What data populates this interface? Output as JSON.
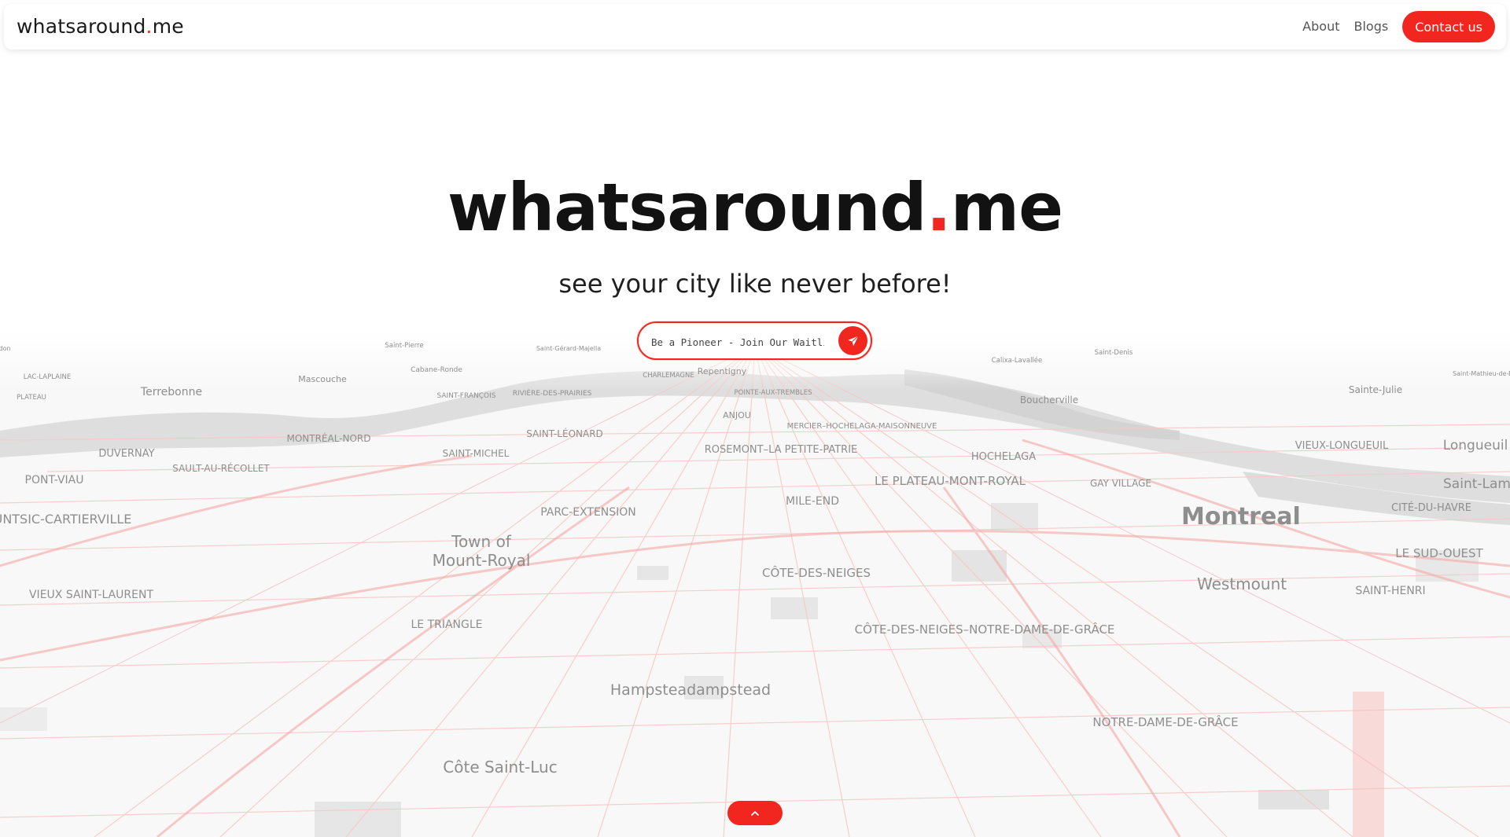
{
  "navbar": {
    "brand": {
      "name": "whatsaround",
      "dot": ".",
      "tld": "me"
    },
    "links": {
      "about": "About",
      "blogs": "Blogs"
    },
    "contact_label": "Contact us"
  },
  "hero": {
    "title": {
      "name": "whatsaround",
      "dot": ".",
      "tld": "me"
    },
    "tagline": "see your city like never before!"
  },
  "waitlist": {
    "placeholder": "Be a Pioneer - Join Our Waitlist",
    "send_icon": "send-icon"
  },
  "scroll_top": {
    "icon": "chevron-up-icon"
  },
  "map": {
    "labels": {
      "l1": "Montreal",
      "l2": "Westmount",
      "l3": "Town of",
      "l4": "Mount-Royal",
      "l5": "Côte Saint-Luc",
      "l6": "Hampsteadampstead",
      "l7": "Terrebonne",
      "l8": "Mascouche",
      "l9": "Boucherville",
      "l10": "Sainte-Julie",
      "l11": "Longueuil",
      "l12": "Saint-Lam",
      "l13": "Repentigny",
      "l14": "Saint-Pierre",
      "l15": "Saint-Gérard-Majella",
      "l16": "Calixa-Lavallée",
      "l17": "Saint-Denis",
      "l18": "Cabane-Ronde",
      "l19": "CHARLEMAGNE",
      "l20": "LAC-LAPLAINE",
      "l21": "PLATEAU",
      "l22": "SAINT-FRANÇOIS",
      "l23": "RIVIÈRE-DES-PRAIRIES",
      "l24": "POINTE-AUX-TREMBLES",
      "l25": "ANJOU",
      "l26": "MERCIER–HOCHELAGA-MAISONNEUVE",
      "l27": "DUVERNAY",
      "l28": "MONTRÉAL-NORD",
      "l29": "SAINT-LÉONARD",
      "l30": "ROSEMONT–LA PETITE-PATRIE",
      "l31": "HOCHELAGA",
      "l32": "VIEUX-LONGUEUIL",
      "l33": "PONT-VIAU",
      "l34": "SAULT-AU-RÉCOLLET",
      "l35": "SAINT-MICHEL",
      "l36": "LE PLATEAU-MONT-ROYAL",
      "l37": "GAY VILLAGE",
      "l38": "AHUNTSIC-CARTIERVILLE",
      "l39": "PARC-EXTENSION",
      "l40": "MILE-END",
      "l41": "CITÉ-DU-HAVRE",
      "l42": "LE SUD-OUEST",
      "l43": "VIEUX SAINT-LAURENT",
      "l44": "CÔTE-DES-NEIGES",
      "l45": "SAINT-HENRI",
      "l46": "LE TRIANGLE",
      "l47": "CÔTE-DES-NEIGES–NOTRE-DAME-DE-GRÂCE",
      "l48": "NOTRE-DAME-DE-GRÂCE",
      "l49": "Saint-Mathieu-de-Beloeil",
      "l50": "don"
    }
  },
  "colors": {
    "accent": "#f0261f",
    "text": "#121212"
  }
}
